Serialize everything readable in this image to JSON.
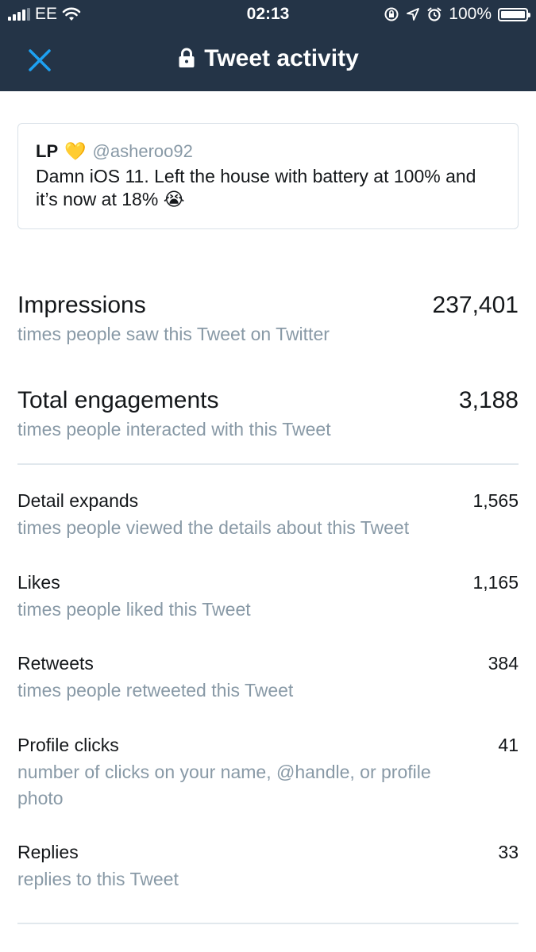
{
  "status_bar": {
    "carrier": "EE",
    "time": "02:13",
    "battery": "100%",
    "icons": [
      "signal-icon",
      "wifi-icon",
      "orientation-lock-icon",
      "location-icon",
      "alarm-icon",
      "battery-icon"
    ]
  },
  "header": {
    "title": "Tweet activity",
    "close_icon": "close-icon",
    "lock_icon": "lock-icon",
    "background": "#243447",
    "accent": "#1da1f2"
  },
  "tweet": {
    "name": "LP",
    "name_emoji": "💛",
    "handle": "@asheroo92",
    "text": "Damn iOS 11. Left the house with battery at 100% and it’s now at 18% 😭"
  },
  "summary": [
    {
      "label": "Impressions",
      "value": "237,401",
      "desc": "times people saw this Tweet on Twitter"
    },
    {
      "label": "Total engagements",
      "value": "3,188",
      "desc": "times people interacted with this Tweet"
    }
  ],
  "details": [
    {
      "label": "Detail expands",
      "value": "1,565",
      "desc": "times people viewed the details about this Tweet"
    },
    {
      "label": "Likes",
      "value": "1,165",
      "desc": "times people liked this Tweet"
    },
    {
      "label": "Retweets",
      "value": "384",
      "desc": "times people retweeted this Tweet"
    },
    {
      "label": "Profile clicks",
      "value": "41",
      "desc": "number of clicks on your name, @handle, or profile photo"
    },
    {
      "label": "Replies",
      "value": "33",
      "desc": "replies to this Tweet"
    }
  ]
}
